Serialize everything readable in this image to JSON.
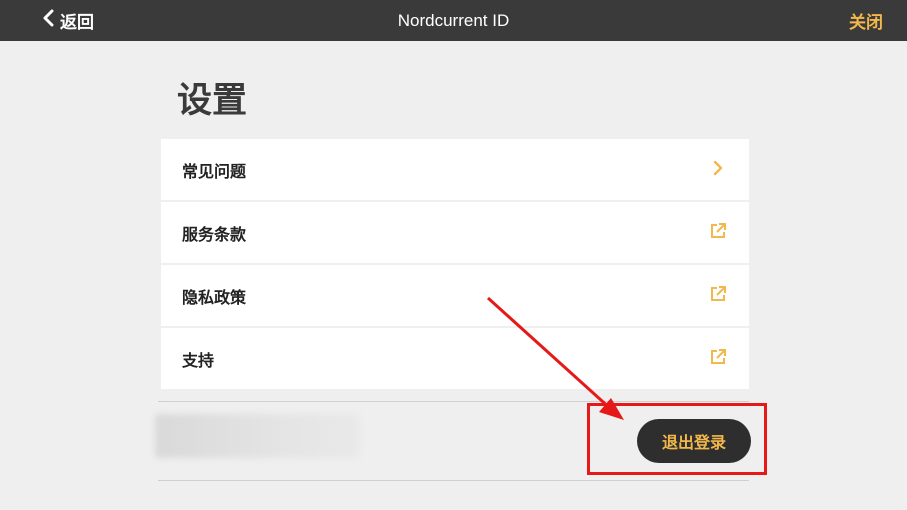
{
  "header": {
    "back_label": "返回",
    "title": "Nordcurrent ID",
    "close_label": "关闭"
  },
  "page": {
    "title": "设置"
  },
  "menu": {
    "items": [
      {
        "label": "常见问题",
        "icon": "chevron-right-icon"
      },
      {
        "label": "服务条款",
        "icon": "external-link-icon"
      },
      {
        "label": "隐私政策",
        "icon": "external-link-icon"
      },
      {
        "label": "支持",
        "icon": "external-link-icon"
      }
    ]
  },
  "account": {
    "logout_label": "退出登录"
  },
  "colors": {
    "accent": "#f2b84b",
    "header_bg": "#3a3a3a",
    "annotation_red": "#e61919"
  }
}
